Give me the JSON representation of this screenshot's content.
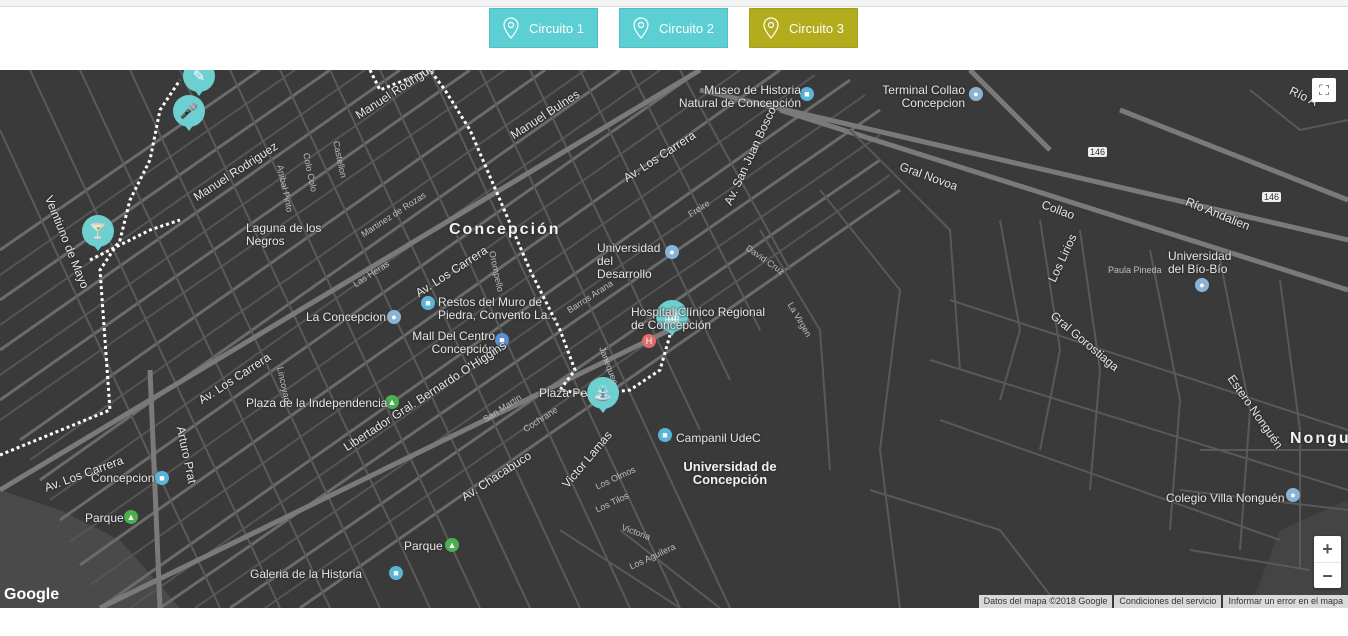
{
  "tabs": [
    {
      "label": "Circuito 1",
      "color": "#5ccfd4"
    },
    {
      "label": "Circuito 2",
      "color": "#5ccfd4"
    },
    {
      "label": "Circuito 3",
      "color": "#b3ad1e"
    }
  ],
  "map": {
    "city_label": "Concepción",
    "district_label": "Nongu",
    "places": {
      "laguna": "Laguna de los Negros",
      "museo": "Museo de Historia Natural de Concepción",
      "terminal": "Terminal Collao Concepcion",
      "univ_desarrollo": "Universidad del Desarrollo",
      "univ_biobio": "Universidad del Bío-Bío",
      "restos": "Restos del Muro de Piedra, Convento La...",
      "la_concepcion": "La Concepcion",
      "mall": "Mall Del Centro Concepción",
      "hospital": "Hospital Clínico Regional de Concepción",
      "plaza_indep": "Plaza de la Independencia",
      "plaza_pe": "Plaza Pe",
      "campanil": "Campanil UdeC",
      "univ_concepcion": "Universidad de Concepción",
      "concepcion_station": "Concepcion",
      "parque1": "Parque",
      "parque2": "Parque",
      "galeria": "Galeria de la Historia",
      "colegio": "Colegio Villa Nonguén",
      "estero": "Estero Nonguén",
      "rio_andalien": "Río Andalien",
      "rio_a": "Río A"
    },
    "streets": {
      "manuel_rodriguez1": "Manuel Rodriguez",
      "manuel_rodriguez2": "Manuel Rodriguez",
      "manuel_bulnes": "Manuel Bulnes",
      "av_los_carrera1": "Av. Los Carrera",
      "av_los_carrera2": "Av. Los Carrera",
      "av_los_carrera3": "Av. Los Carrera",
      "av_los_carrera4": "Av. Los Carrera",
      "av_chacabuco": "Av. Chacabuco",
      "libertador": "Libertador Gral. Bernardo O'Higgins",
      "arturo_prat": "Arturo Prat",
      "victor_lamas": "Victor Lamas",
      "gral_novoa": "Gral Novoa",
      "collao": "Collao",
      "los_lirios": "Los Lirios",
      "gral_gorostiaga": "Gral Gorostiaga",
      "av_san_juan_bosco": "Av. San Juan Bosco",
      "veintiuno_de_mayo": "Veintiuno de Mayo",
      "janequeo": "Janequeo",
      "barros_arana": "Barros Arana",
      "san_martin": "San Martin",
      "cochrane": "Cochrane",
      "freire": "Freire",
      "las_heras": "Las Heras",
      "martinez_de_rozas": "Martinez de Rozas",
      "lincoyan": "Lincoyan",
      "anibal_pinto": "Anibal Pinto",
      "castellon": "Castellon",
      "colo_colo": "Colo Colo",
      "orompello": "Orompello",
      "victoria": "Victoria",
      "los_olmos": "Los Olmos",
      "los_tilos": "Los Tilos",
      "los_aguilera": "Los Aguilera",
      "david_cruz": "David Cruz",
      "la_virgen": "La Virgen",
      "paula_pineda": "Paula Pineda",
      "route_146a": "146",
      "route_146b": "146"
    },
    "google_logo": "Google",
    "attribution": [
      "Datos del mapa ©2018 Google",
      "Condiciones del servicio",
      "Informar un error en el mapa"
    ],
    "zoom_in": "+",
    "zoom_out": "−",
    "fullscreen": "⛶"
  }
}
